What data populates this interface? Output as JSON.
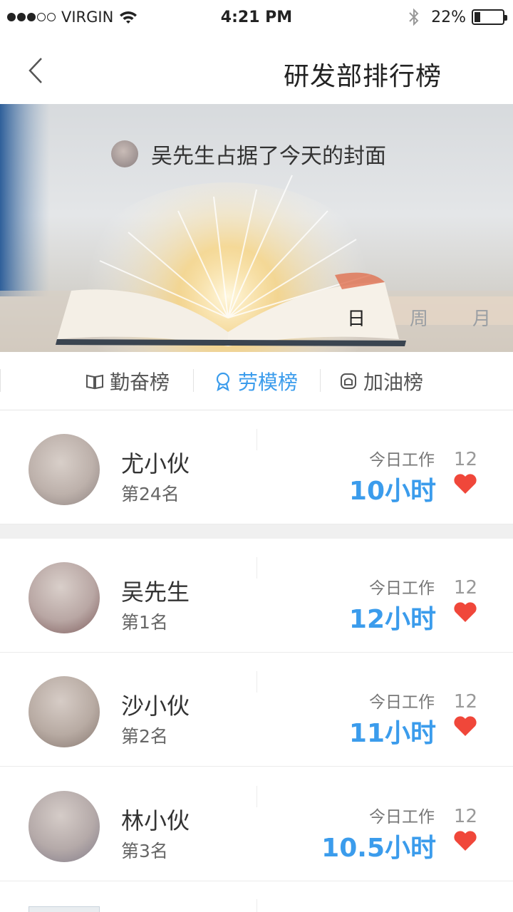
{
  "status_bar": {
    "carrier": "VIRGIN",
    "time": "4:21 PM",
    "battery_percent": "22%",
    "battery_level": 0.22,
    "signal_filled": 3,
    "signal_total": 5
  },
  "nav": {
    "title": "研发部排行榜",
    "back_icon": "chevron-left-icon"
  },
  "banner": {
    "cover_text": "吴先生占据了今天的封面",
    "period_tabs": [
      "日",
      "周",
      "月"
    ],
    "active_period": "日"
  },
  "category_tabs": [
    {
      "label": "勤奋榜",
      "icon": "book-icon",
      "active": false
    },
    {
      "label": "劳模榜",
      "icon": "medal-icon",
      "active": true
    },
    {
      "label": "加油榜",
      "icon": "fuel-icon",
      "active": false
    }
  ],
  "accent_color": "#3b9cec",
  "heart_color": "#f0473a",
  "my_rank": {
    "name": "尤小伙",
    "rank": "第24名",
    "work_label": "今日工作",
    "hours": "10小时",
    "likes": "12"
  },
  "ranking": [
    {
      "name": "吴先生",
      "rank": "第1名",
      "work_label": "今日工作",
      "hours": "12小时",
      "likes": "12"
    },
    {
      "name": "沙小伙",
      "rank": "第2名",
      "work_label": "今日工作",
      "hours": "11小时",
      "likes": "12"
    },
    {
      "name": "林小伙",
      "rank": "第3名",
      "work_label": "今日工作",
      "hours": "10.5小时",
      "likes": "12"
    }
  ]
}
